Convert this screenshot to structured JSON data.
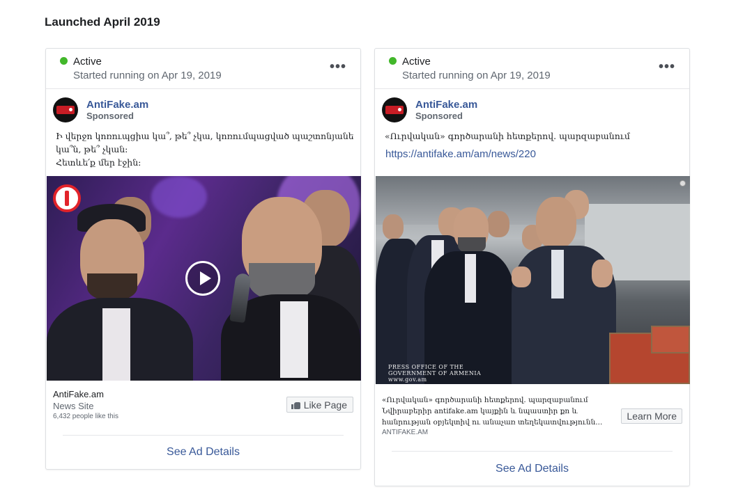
{
  "section": {
    "title": "Launched April 2019"
  },
  "ads": [
    {
      "status": "Active",
      "started": "Started running on Apr 19, 2019",
      "more_label": "•••",
      "page_name": "AntiFake.am",
      "sponsored": "Sponsored",
      "body_lines": [
        "Ի վերջո կոռուպցիա կա՞, թե՞ չկա, կոռումպացված պաշտոնյաներ",
        "կա՞ն, թե՞ չկան։",
        "Հետևե՛ք մեր էջին։"
      ],
      "media": "video",
      "footer_name": "AntiFake.am",
      "footer_category": "News Site",
      "footer_likes": "6,432 people like this",
      "cta_label": "Like Page",
      "cta_icon": "thumbs-up-icon",
      "see_details": "See Ad Details"
    },
    {
      "status": "Active",
      "started": "Started running on Apr 19, 2019",
      "more_label": "•••",
      "page_name": "AntiFake.am",
      "sponsored": "Sponsored",
      "body_lines": [
        "«Ուրվական» գործարանի հետքերով. պարզաբանում"
      ],
      "link": "https://antifake.am/am/news/220",
      "media": "photo",
      "watermark_lines": [
        "PRESS OFFICE OF THE",
        "GOVERNMENT OF ARMENIA",
        "www.gov.am"
      ],
      "footer_lines": [
        "«Ուրվական» գործարանի հետքերով. պարզաբանում",
        "Նվիրաբերիր antifake.am կայքին և նպաստիր քո և",
        "հանրության օբյեկտիվ ու անաչառ տեղեկատվությունն..."
      ],
      "footer_domain": "ANTIFAKE.AM",
      "cta_label": "Learn More",
      "see_details": "See Ad Details"
    }
  ],
  "colors": {
    "active": "#42b72a",
    "link": "#385898",
    "border": "#dddfe2"
  }
}
